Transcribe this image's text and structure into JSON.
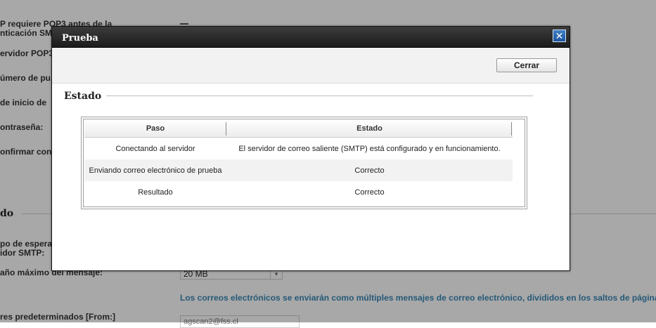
{
  "background": {
    "labels": [
      "P requiere POP3 antes de la",
      "nticación SMT",
      "ervidor POP3",
      "úmero de pu",
      "de inicio de",
      "ontraseña:",
      "onfirmar con",
      "po de espera",
      "idor SMTP:",
      "año máximo del mensaje:",
      "res predeterminados [From:]"
    ],
    "section_title": "do",
    "max_size_value": "20 MB",
    "note": "Los correos electrónicos se enviarán como múltiples mensajes de correo electrónico, divididos en los saltos de página",
    "from_value": "agscan2@fss.cl"
  },
  "dialog": {
    "title": "Prueba",
    "close_glyph": "✕",
    "close_button_label": "Cerrar",
    "section_title": "Estado",
    "table": {
      "headers": [
        "Paso",
        "Estado"
      ],
      "rows": [
        [
          "Conectando al servidor",
          "El servidor de correo saliente (SMTP) está configurado y en funcionamiento."
        ],
        [
          "Enviando correo electrónico de prueba",
          "Correcto"
        ],
        [
          "Resultado",
          "Correcto"
        ]
      ]
    }
  },
  "colors": {
    "titlebar": "#2b2b2b",
    "close_button": "#2d6ab3",
    "note_link": "#3a87b5",
    "overlay": "rgba(0,0,0,0.34)"
  }
}
